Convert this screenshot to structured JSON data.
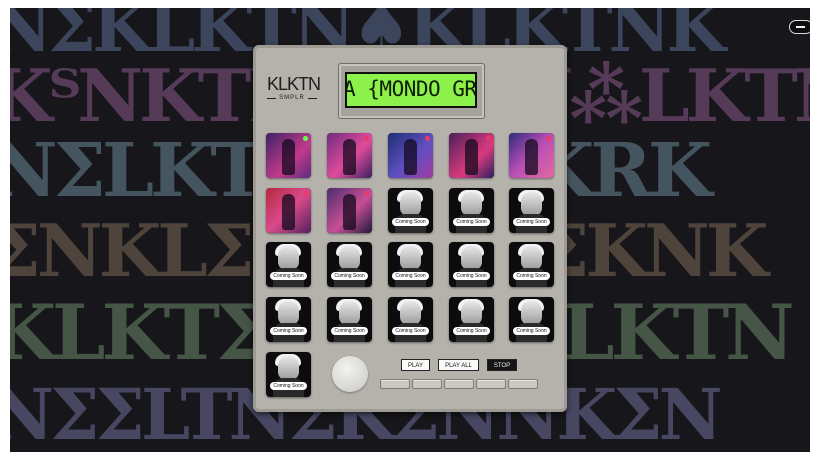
{
  "app": {
    "logo": "KLKTN",
    "logo_sub": "SMPLR"
  },
  "display": {
    "text": "A {MONDO GRO"
  },
  "pads": [
    {
      "label": "",
      "status": "sample"
    },
    {
      "label": "",
      "status": "sample"
    },
    {
      "label": "",
      "status": "sample"
    },
    {
      "label": "",
      "status": "sample"
    },
    {
      "label": "",
      "status": "sample"
    },
    {
      "label": "",
      "status": "sample"
    },
    {
      "label": "",
      "status": "sample"
    },
    {
      "label": "Coming Soon",
      "status": "coming"
    },
    {
      "label": "Coming Soon",
      "status": "coming"
    },
    {
      "label": "Coming Soon",
      "status": "coming"
    },
    {
      "label": "Coming Soon",
      "status": "coming"
    },
    {
      "label": "Coming Soon",
      "status": "coming"
    },
    {
      "label": "Coming Soon",
      "status": "coming"
    },
    {
      "label": "Coming Soon",
      "status": "coming"
    },
    {
      "label": "Coming Soon",
      "status": "coming"
    },
    {
      "label": "Coming Soon",
      "status": "coming"
    },
    {
      "label": "Coming Soon",
      "status": "coming"
    },
    {
      "label": "Coming Soon",
      "status": "coming"
    },
    {
      "label": "Coming Soon",
      "status": "coming"
    },
    {
      "label": "Coming Soon",
      "status": "coming"
    },
    {
      "label": "Coming Soon",
      "status": "coming"
    }
  ],
  "controls": {
    "play": "PLAY",
    "play_all": "PLAY ALL",
    "stop": "STOP"
  },
  "background_letters": [
    "NΣKLKTN♠KLKTNK",
    "KᵀNKTΣKLKTN⁂LKTN",
    "NΣLKTΣNKΣLKRK",
    "ΣNKLΣNKΣNKΣKNK",
    "KLKTΣNKTNΣLKTN",
    "NΣΣLTNΣKΣNNKΣN"
  ],
  "colors": {
    "accent": "#8cf14a",
    "device": "#b4b2ab",
    "background": "#17161a"
  },
  "icons": {
    "menu": "menu-icon",
    "knob": "knob-icon"
  }
}
